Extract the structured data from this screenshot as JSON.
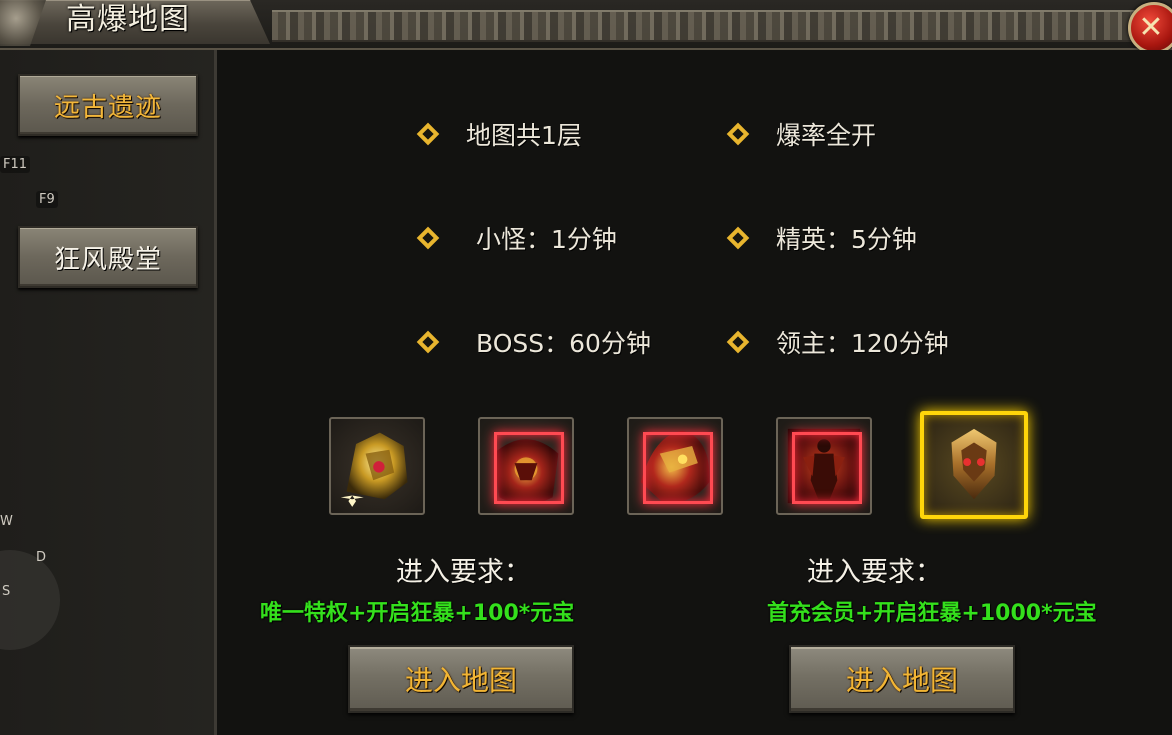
{
  "window": {
    "title": "高爆地图",
    "close_label": "✕"
  },
  "sidebar": {
    "items": [
      {
        "label": "远古遗迹",
        "state": "active"
      },
      {
        "label": "狂风殿堂",
        "state": "normal"
      }
    ],
    "hotkeys": [
      "F11",
      "F9"
    ],
    "joystick_keys": {
      "up": "W",
      "right": "D",
      "down": "S"
    }
  },
  "info": {
    "rows": [
      {
        "left": "地图共1层",
        "right": "爆率全开"
      },
      {
        "left": "小怪：1分钟",
        "right": "精英：5分钟"
      },
      {
        "left": "BOSS：60分钟",
        "right": "领主：120分钟"
      }
    ]
  },
  "rewards": [
    {
      "icon": "gold-helmet-icon",
      "rarity": "normal"
    },
    {
      "icon": "red-armor-icon",
      "rarity": "red"
    },
    {
      "icon": "red-dragon-helmet-icon",
      "rarity": "red"
    },
    {
      "icon": "red-figure-icon",
      "rarity": "red"
    },
    {
      "icon": "gold-crest-icon",
      "rarity": "gold"
    }
  ],
  "entries": [
    {
      "req_label": "进入要求：",
      "req_text": "唯一特权+开启狂暴+100*元宝",
      "button": "进入地图"
    },
    {
      "req_label": "进入要求：",
      "req_text": "首充会员+开启狂暴+1000*元宝",
      "button": "进入地图"
    }
  ],
  "colors": {
    "accent_gold": "#f2b534",
    "requirement_green": "#34e01c",
    "diamond": "#e8b52e",
    "red_frame": "#ff4a52",
    "gold_frame": "#ffd60a"
  }
}
